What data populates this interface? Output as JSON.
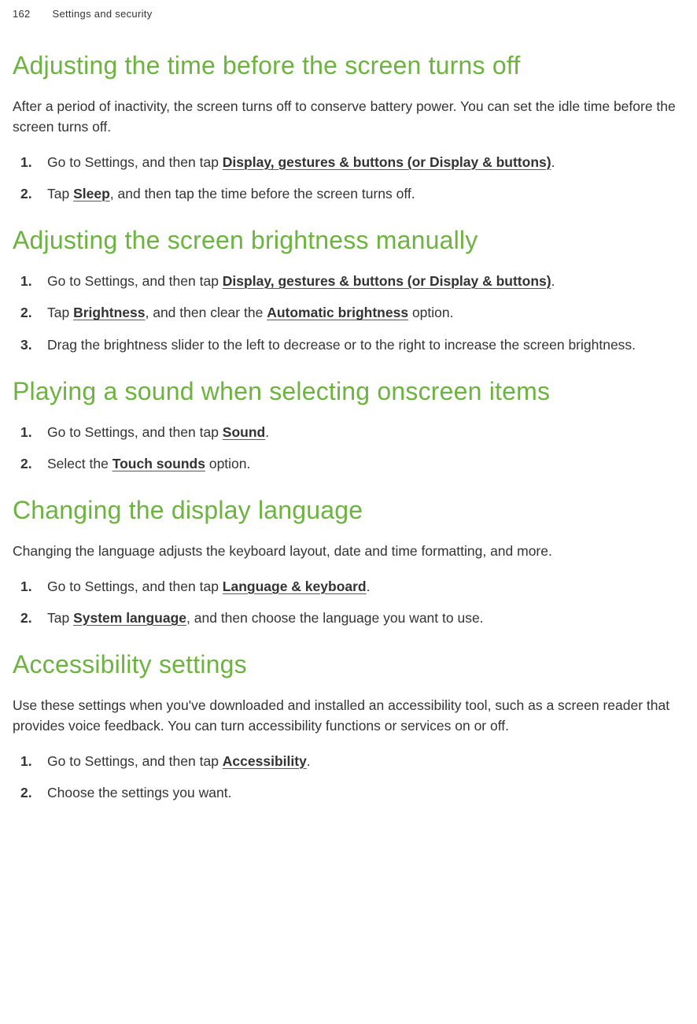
{
  "header": {
    "page_number": "162",
    "section": "Settings and security"
  },
  "sections": [
    {
      "title": "Adjusting the time before the screen turns off",
      "intro": "After a period of inactivity, the screen turns off to conserve battery power. You can set the idle time before the screen turns off.",
      "steps": [
        {
          "pre": "Go to Settings, and then tap ",
          "bold": "Display, gestures & buttons (or Display & buttons)",
          "post": "."
        },
        {
          "pre": "Tap ",
          "bold": "Sleep",
          "post": ", and then tap the time before the screen turns off."
        }
      ]
    },
    {
      "title": "Adjusting the screen brightness manually",
      "intro": "",
      "steps": [
        {
          "pre": "Go to Settings, and then tap ",
          "bold": "Display, gestures & buttons (or Display & buttons)",
          "post": "."
        },
        {
          "pre": "Tap ",
          "bold": "Brightness",
          "post": ", and then clear the ",
          "bold2": "Automatic brightness",
          "post2": " option."
        },
        {
          "pre": "Drag the brightness slider to the left to decrease or to the right to increase the screen brightness.",
          "bold": "",
          "post": ""
        }
      ]
    },
    {
      "title": "Playing a sound when selecting onscreen items",
      "intro": "",
      "steps": [
        {
          "pre": "Go to Settings, and then tap ",
          "bold": "Sound",
          "post": "."
        },
        {
          "pre": "Select the ",
          "bold": "Touch sounds",
          "post": " option."
        }
      ]
    },
    {
      "title": "Changing the display language",
      "intro": "Changing the language adjusts the keyboard layout, date and time formatting, and more.",
      "steps": [
        {
          "pre": "Go to Settings, and then tap ",
          "bold": "Language & keyboard",
          "post": "."
        },
        {
          "pre": "Tap ",
          "bold": "System language",
          "post": ", and then choose the language you want to use."
        }
      ]
    },
    {
      "title": "Accessibility settings",
      "intro": "Use these settings when you've downloaded and installed an accessibility tool, such as a screen reader that provides voice feedback. You can turn accessibility functions or services on or off.",
      "steps": [
        {
          "pre": "Go to Settings, and then tap ",
          "bold": "Accessibility",
          "post": "."
        },
        {
          "pre": "Choose the settings you want.",
          "bold": "",
          "post": ""
        }
      ]
    }
  ]
}
